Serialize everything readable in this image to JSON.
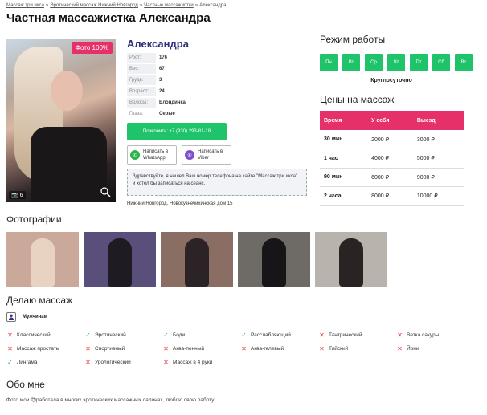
{
  "breadcrumb": {
    "items": [
      "Массаж три икса",
      "Эротический массаж Нижний Новгород",
      "Частные массажистки",
      "Александра"
    ]
  },
  "title": "Частная массажистка Александра",
  "photo": {
    "badge": "Фото 100%",
    "count": "6"
  },
  "profile": {
    "name": "Александра",
    "attrs": [
      {
        "k": "Рост:",
        "v": "176"
      },
      {
        "k": "Вес:",
        "v": "67"
      },
      {
        "k": "Грудь:",
        "v": "3"
      },
      {
        "k": "Возраст:",
        "v": "24"
      },
      {
        "k": "Волосы:",
        "v": "Блондинка"
      },
      {
        "k": "Глаза:",
        "v": "Серые"
      }
    ],
    "call_label": "Позвонить: +7 (930) 293-81-18",
    "whatsapp_label": "Написать в WhatsApp",
    "viber_label": "Написать в Viber",
    "note": "Здравствуйте, я нашел Ваш номер телефона на сайте \"Массаж три икса\" и хотел бы записаться на сеанс.",
    "address": "Нижний Новгород, Новокузнечихинская дом 15"
  },
  "schedule": {
    "title": "Режим работы",
    "days": [
      "Пн",
      "Вт",
      "Ср",
      "Чт",
      "Пт",
      "Сб",
      "Вс"
    ],
    "hours": "Круглосуточно"
  },
  "prices": {
    "title": "Цены на массаж",
    "headers": [
      "Время",
      "У себя",
      "Выезд"
    ],
    "rows": [
      [
        "30 мин",
        "2000 ₽",
        "3000 ₽"
      ],
      [
        "1 час",
        "4000 ₽",
        "5000 ₽"
      ],
      [
        "90 мин",
        "6000 ₽",
        "9000 ₽"
      ],
      [
        "2 часа",
        "8000 ₽",
        "10000 ₽"
      ]
    ]
  },
  "photos_title": "Фотографии",
  "thumbs": [
    {
      "bg": "#caa89a",
      "fig": "#e8d2c1"
    },
    {
      "bg": "#5a4f7a",
      "fig": "#1e1b22"
    },
    {
      "bg": "#8b6e63",
      "fig": "#2b2326"
    },
    {
      "bg": "#6e6a66",
      "fig": "#171518"
    },
    {
      "bg": "#b8b3ad",
      "fig": "#2a2324"
    }
  ],
  "services": {
    "title": "Делаю массаж",
    "category": "Мужчинам",
    "items": [
      {
        "label": "Классический",
        "ok": false
      },
      {
        "label": "Эротический",
        "ok": true
      },
      {
        "label": "Боди",
        "ok": true
      },
      {
        "label": "Расслабляющий",
        "ok": true
      },
      {
        "label": "Тантрический",
        "ok": false
      },
      {
        "label": "Ветка сакуры",
        "ok": false
      },
      {
        "label": "Массаж простаты",
        "ok": false
      },
      {
        "label": "Спортивный",
        "ok": false
      },
      {
        "label": "Аква-пенный",
        "ok": false
      },
      {
        "label": "Аква-гелевый",
        "ok": false
      },
      {
        "label": "Тайский",
        "ok": false
      },
      {
        "label": "Йони",
        "ok": false
      },
      {
        "label": "Лингама",
        "ok": true
      },
      {
        "label": "Урологический",
        "ok": false
      },
      {
        "label": "Массаж в 4 руки",
        "ok": false
      }
    ]
  },
  "about": {
    "title": "Обо мне",
    "text": "Фото мои 😍работала в многих эротических массажных салонах, люблю свою работу."
  },
  "colors": {
    "accent_pink": "#e6306a",
    "accent_green": "#1ec36a",
    "brand_navy": "#2d2f7a"
  }
}
